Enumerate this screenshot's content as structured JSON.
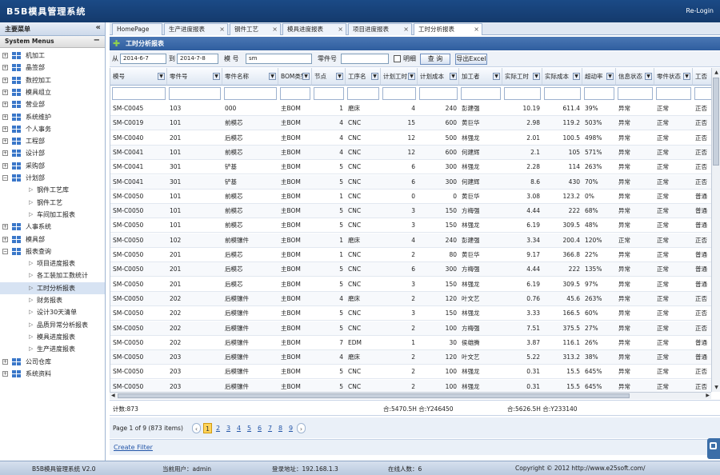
{
  "app_title": "B5B模具管理系统",
  "logout": "Re-Login",
  "sidebar": {
    "header": "主要菜单",
    "collapse_icon": "«",
    "system_menus": "System Menus",
    "system_menus_icon": "−",
    "nodes": [
      {
        "label": "机加工",
        "pm": "+",
        "kind": "root"
      },
      {
        "label": "晶签部",
        "pm": "+",
        "kind": "root"
      },
      {
        "label": "数控加工",
        "pm": "+",
        "kind": "root"
      },
      {
        "label": "模具组立",
        "pm": "+",
        "kind": "root"
      },
      {
        "label": "营业部",
        "pm": "+",
        "kind": "root"
      },
      {
        "label": "系统维护",
        "pm": "+",
        "kind": "root"
      },
      {
        "label": "个人事务",
        "pm": "+",
        "kind": "root"
      },
      {
        "label": "工程部",
        "pm": "+",
        "kind": "root"
      },
      {
        "label": "设计部",
        "pm": "+",
        "kind": "root"
      },
      {
        "label": "采购部",
        "pm": "+",
        "kind": "root"
      },
      {
        "label": "计划部",
        "pm": "−",
        "kind": "root"
      },
      {
        "label": "钢件工艺库",
        "kind": "child"
      },
      {
        "label": "钢件工艺",
        "kind": "child"
      },
      {
        "label": "车间加工报表",
        "kind": "child"
      },
      {
        "label": "人事系统",
        "pm": "+",
        "kind": "root"
      },
      {
        "label": "模具部",
        "pm": "+",
        "kind": "root"
      },
      {
        "label": "报表查询",
        "pm": "−",
        "kind": "root"
      },
      {
        "label": "项目进度报表",
        "kind": "child"
      },
      {
        "label": "各工装加工数统计",
        "kind": "child"
      },
      {
        "label": "工时分析报表",
        "kind": "child",
        "selected": true
      },
      {
        "label": "财务报表",
        "kind": "child"
      },
      {
        "label": "设计30天清单",
        "kind": "child"
      },
      {
        "label": "品质异常分析报表",
        "kind": "child"
      },
      {
        "label": "模具进度报表",
        "kind": "child"
      },
      {
        "label": "生产进度报表",
        "kind": "child"
      },
      {
        "label": "公司仓库",
        "pm": "+",
        "kind": "root"
      },
      {
        "label": "系统资料",
        "pm": "+",
        "kind": "root"
      }
    ]
  },
  "tabs": [
    {
      "label": "HomePage",
      "close": ""
    },
    {
      "label": "生产进度报表",
      "close": "×"
    },
    {
      "label": "钢件工艺",
      "close": "×"
    },
    {
      "label": "模具进度报表",
      "close": "×"
    },
    {
      "label": "项目进度报表",
      "close": "×"
    },
    {
      "label": "工时分析报表",
      "close": "×",
      "active": true
    }
  ],
  "panel": {
    "title": "工时分析报表",
    "icon": "✚"
  },
  "filter": {
    "from_label": "从",
    "from_value": "2014-6-7",
    "to_label": "到",
    "to_value": "2014-7-8",
    "mold_label": "模 号",
    "mold_value": "sm",
    "part_label": "零件号",
    "part_value": "",
    "checkbox_label": "明细",
    "search_button": "查 询",
    "export_button": "导出Excel"
  },
  "columns": [
    "模号",
    "零件号",
    "零件名称",
    "BOM类型",
    "节点",
    "工序名",
    "计划工时",
    "计划成本",
    "加工者",
    "实际工时",
    "实际成本",
    "超动率",
    "信息状态",
    "零件状态",
    "工否"
  ],
  "rows": [
    [
      "SM-C0045",
      "103",
      "000",
      "主BOM",
      "1",
      "磨床",
      "4",
      "240",
      "彭建强",
      "10.19",
      "611.4",
      "39%",
      "异常",
      "正常",
      "正否"
    ],
    [
      "SM-C0019",
      "101",
      "前模芯",
      "主BOM",
      "4",
      "CNC",
      "15",
      "600",
      "黄巨华",
      "2.98",
      "119.2",
      "503%",
      "异常",
      "正常",
      "正否"
    ],
    [
      "SM-C0040",
      "201",
      "后模芯",
      "主BOM",
      "4",
      "CNC",
      "12",
      "500",
      "林强龙",
      "2.01",
      "100.5",
      "498%",
      "异常",
      "正常",
      "正否"
    ],
    [
      "SM-C0041",
      "101",
      "前模芯",
      "主BOM",
      "4",
      "CNC",
      "12",
      "600",
      "何建辉",
      "2.1",
      "105",
      "571%",
      "异常",
      "正常",
      "正否"
    ],
    [
      "SM-C0041",
      "301",
      "铲基",
      "主BOM",
      "5",
      "CNC",
      "6",
      "300",
      "林强龙",
      "2.28",
      "114",
      "263%",
      "异常",
      "正常",
      "正否"
    ],
    [
      "SM-C0041",
      "301",
      "铲基",
      "主BOM",
      "5",
      "CNC",
      "6",
      "300",
      "何建辉",
      "8.6",
      "430",
      "70%",
      "异常",
      "正常",
      "正否"
    ],
    [
      "SM-C0050",
      "101",
      "前模芯",
      "主BOM",
      "1",
      "CNC",
      "0",
      "0",
      "黄巨华",
      "3.08",
      "123.2",
      "0%",
      "异常",
      "正常",
      "普通"
    ],
    [
      "SM-C0050",
      "101",
      "前模芯",
      "主BOM",
      "5",
      "CNC",
      "3",
      "150",
      "方梅强",
      "4.44",
      "222",
      "68%",
      "异常",
      "正常",
      "普通"
    ],
    [
      "SM-C0050",
      "101",
      "前模芯",
      "主BOM",
      "5",
      "CNC",
      "3",
      "150",
      "林强龙",
      "6.19",
      "309.5",
      "48%",
      "异常",
      "正常",
      "普通"
    ],
    [
      "SM-C0050",
      "102",
      "前模镶件",
      "主BOM",
      "1",
      "磨床",
      "4",
      "240",
      "彭建强",
      "3.34",
      "200.4",
      "120%",
      "正常",
      "正常",
      "正否"
    ],
    [
      "SM-C0050",
      "201",
      "后模芯",
      "主BOM",
      "1",
      "CNC",
      "2",
      "80",
      "黄巨华",
      "9.17",
      "366.8",
      "22%",
      "异常",
      "正常",
      "普通"
    ],
    [
      "SM-C0050",
      "201",
      "后模芯",
      "主BOM",
      "5",
      "CNC",
      "6",
      "300",
      "方梅强",
      "4.44",
      "222",
      "135%",
      "异常",
      "正常",
      "普通"
    ],
    [
      "SM-C0050",
      "201",
      "后模芯",
      "主BOM",
      "5",
      "CNC",
      "3",
      "150",
      "林强龙",
      "6.19",
      "309.5",
      "97%",
      "异常",
      "正常",
      "普通"
    ],
    [
      "SM-C0050",
      "202",
      "后模镶件",
      "主BOM",
      "4",
      "磨床",
      "2",
      "120",
      "叶文艺",
      "0.76",
      "45.6",
      "263%",
      "异常",
      "正常",
      "正否"
    ],
    [
      "SM-C0050",
      "202",
      "后模镶件",
      "主BOM",
      "5",
      "CNC",
      "3",
      "150",
      "林强龙",
      "3.33",
      "166.5",
      "60%",
      "异常",
      "正常",
      "正否"
    ],
    [
      "SM-C0050",
      "202",
      "后模镶件",
      "主BOM",
      "5",
      "CNC",
      "2",
      "100",
      "方梅强",
      "7.51",
      "375.5",
      "27%",
      "异常",
      "正常",
      "正否"
    ],
    [
      "SM-C0050",
      "202",
      "后模镶件",
      "主BOM",
      "7",
      "EDM",
      "1",
      "30",
      "侯雄腾",
      "3.87",
      "116.1",
      "26%",
      "异常",
      "正常",
      "普通"
    ],
    [
      "SM-C0050",
      "203",
      "后模镶件",
      "主BOM",
      "4",
      "磨床",
      "2",
      "120",
      "叶文艺",
      "5.22",
      "313.2",
      "38%",
      "异常",
      "正常",
      "普通"
    ],
    [
      "SM-C0050",
      "203",
      "后模镶件",
      "主BOM",
      "5",
      "CNC",
      "2",
      "100",
      "林强龙",
      "0.31",
      "15.5",
      "645%",
      "异常",
      "正常",
      "正否"
    ],
    [
      "SM-C0050",
      "203",
      "后模镶件",
      "主BOM",
      "5",
      "CNC",
      "2",
      "100",
      "林强龙",
      "0.31",
      "15.5",
      "645%",
      "异常",
      "正常",
      "正否"
    ]
  ],
  "summary": {
    "count": "计数:873",
    "plan_total": "合:5470.5H  合:Y246450",
    "actual_total": "合:5626.5H  合:Y233140"
  },
  "pager": {
    "info": "Page 1 of 9 (873 items)",
    "prev": "‹",
    "next": "›",
    "pages": [
      "1",
      "2",
      "3",
      "4",
      "5",
      "6",
      "7",
      "8",
      "9"
    ],
    "current": "1"
  },
  "create_filter": "Create Filter",
  "status": {
    "system": "B5B模具管理系统 V2.0",
    "user": "当前用户：admin",
    "ip": "登录地址：192.168.1.3",
    "online": "在线人数：6",
    "copyright": "Copyright © 2012 http://www.e25soft.com/"
  },
  "colors": {
    "title_bar": "#1b4a86",
    "panel_header": "#3a6aad",
    "accent": "#ffd45a"
  }
}
